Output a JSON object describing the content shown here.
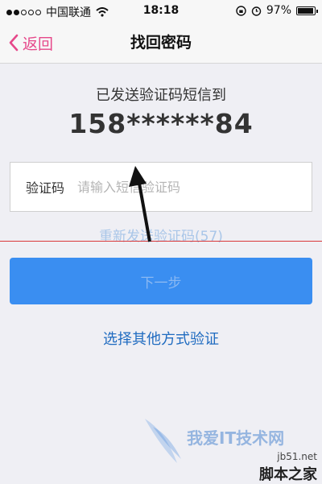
{
  "status_bar": {
    "carrier": "中国联通",
    "time": "18:18",
    "battery": "97%",
    "battery_level": 0.97
  },
  "nav": {
    "back_label": "返回",
    "title": "找回密码"
  },
  "main": {
    "sent_label": "已发送验证码短信到",
    "phone_number": "158******84",
    "code_field": {
      "label": "验证码",
      "placeholder": "请输入短信验证码"
    },
    "resend_label": "重新发送验证码(57)",
    "next_label": "下一步",
    "other_method_label": "选择其他方式验证"
  },
  "watermark": {
    "text": "我爱IT技术网",
    "site_domain": "jb51.net",
    "site_name": "脚本之家"
  },
  "colors": {
    "accent_pink": "#e6488a",
    "primary_blue": "#3a8ef1",
    "link_blue": "#1f6bc0",
    "annotation_red": "#d9383a"
  }
}
